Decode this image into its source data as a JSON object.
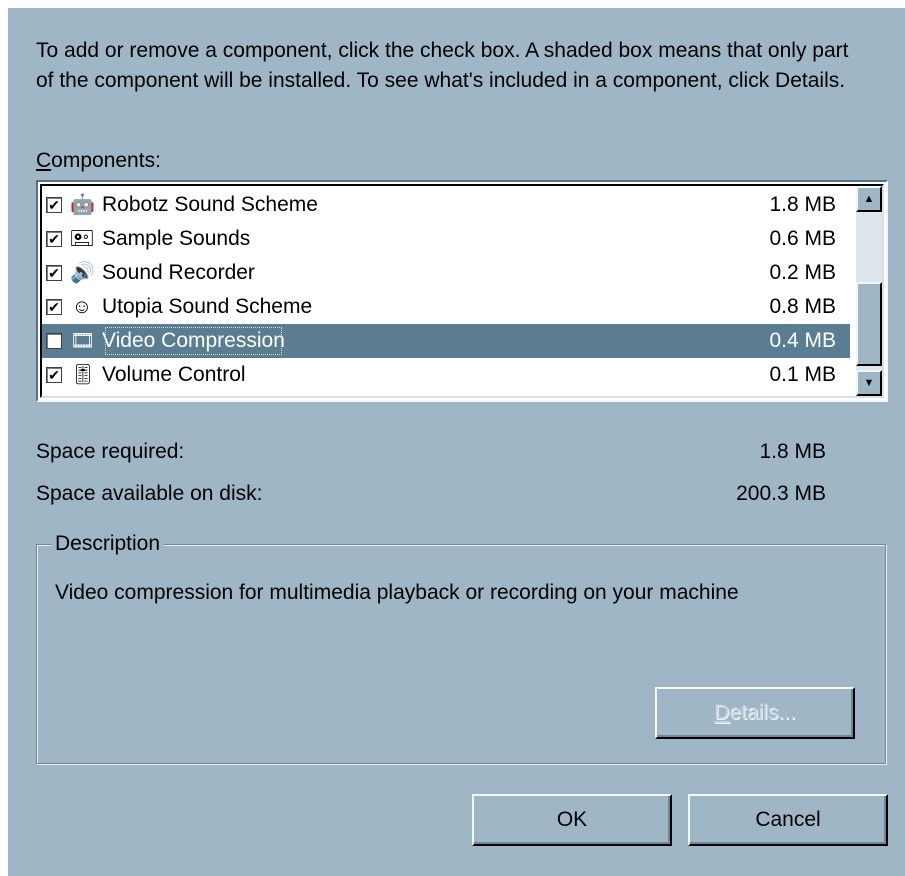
{
  "intro_text": "To add or remove a component, click the check box. A shaded box means that only part of the component will be installed. To see what's included in a component, click Details.",
  "components_label": {
    "accel": "C",
    "rest": "omponents:"
  },
  "components": [
    {
      "name": "Robotz Sound Scheme",
      "size": "1.8 MB",
      "checked": true,
      "icon": "robot-icon",
      "glyph": "🤖",
      "selected": false
    },
    {
      "name": "Sample Sounds",
      "size": "0.6 MB",
      "checked": true,
      "icon": "sound-file-icon",
      "glyph": "🖭",
      "selected": false
    },
    {
      "name": "Sound Recorder",
      "size": "0.2 MB",
      "checked": true,
      "icon": "speaker-icon",
      "glyph": "🔊",
      "selected": false
    },
    {
      "name": "Utopia Sound Scheme",
      "size": "0.8 MB",
      "checked": true,
      "icon": "smiley-icon",
      "glyph": "☺",
      "selected": false
    },
    {
      "name": "Video Compression",
      "size": "0.4 MB",
      "checked": false,
      "icon": "video-compression-icon",
      "glyph": "🎞",
      "selected": true
    },
    {
      "name": "Volume Control",
      "size": "0.1 MB",
      "checked": true,
      "icon": "volume-control-icon",
      "glyph": "🎚",
      "selected": false
    }
  ],
  "space_required": {
    "label": "Space required:",
    "value": "1.8 MB"
  },
  "space_available": {
    "label": "Space available on disk:",
    "value": "200.3 MB"
  },
  "description": {
    "legend": "Description",
    "text": "Video compression for multimedia playback or recording on your machine"
  },
  "buttons": {
    "details": {
      "accel": "D",
      "rest": "etails..."
    },
    "ok": "OK",
    "cancel": "Cancel"
  },
  "colors": {
    "dialog_bg": "#9fb6c6",
    "selection": "#5b7d92"
  }
}
